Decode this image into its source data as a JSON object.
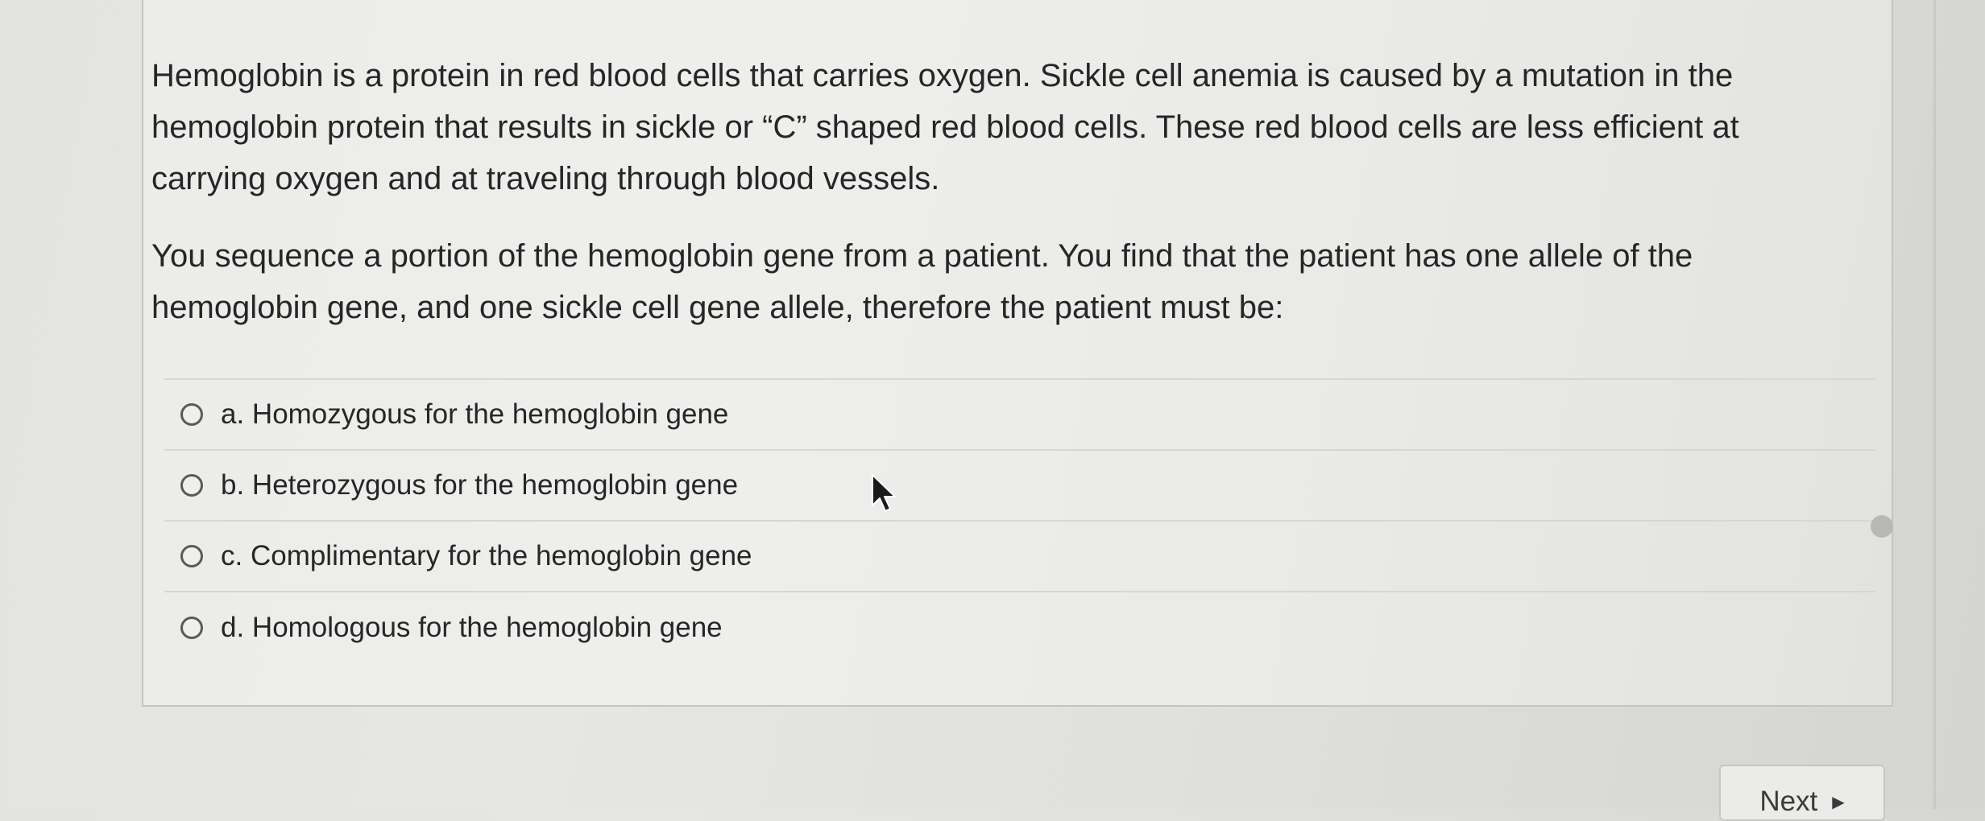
{
  "question": {
    "paragraph1": "Hemoglobin is a protein in red blood cells that carries oxygen.  Sickle cell anemia is caused by a mutation in the hemoglobin protein that results in sickle or “C” shaped red blood cells.  These red blood cells are less efficient at carrying oxygen and at traveling through blood vessels.",
    "paragraph2": "You sequence a portion of the hemoglobin gene from a patient. You find that the patient has one allele of the hemoglobin gene, and one sickle cell gene allele, therefore the patient must be:"
  },
  "answers": [
    {
      "label": "a. Homozygous for the hemoglobin gene"
    },
    {
      "label": "b. Heterozygous for the hemoglobin gene"
    },
    {
      "label": "c. Complimentary for the hemoglobin gene"
    },
    {
      "label": "d. Homologous for the hemoglobin gene"
    }
  ],
  "navigation": {
    "next_label": "Next",
    "next_icon": "triangle-right-icon"
  },
  "colors": {
    "background": "#e3e3e1",
    "panel": "#ececea",
    "text": "#262626",
    "divider": "#d6d6d4"
  }
}
